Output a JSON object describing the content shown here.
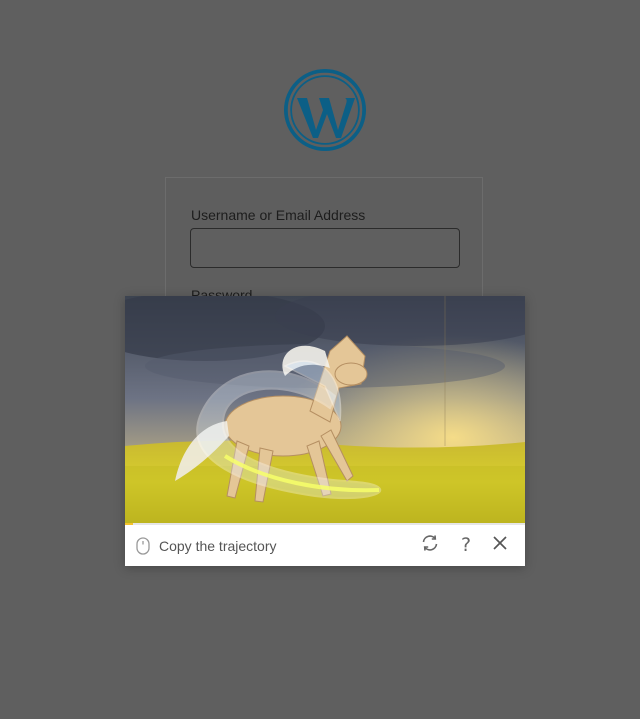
{
  "login": {
    "username_label": "Username or Email Address",
    "username_value": "",
    "password_label": "Password"
  },
  "captcha": {
    "instruction": "Copy the trajectory",
    "icons": {
      "mouse": "mouse-icon",
      "refresh": "refresh-icon",
      "help": "help-icon",
      "close": "close-icon"
    },
    "help_glyph": "?"
  },
  "colors": {
    "overlay": "#5f5f5f",
    "wordpress_blue": "#0c5f86",
    "captcha_accent": "#f4c32b"
  },
  "icons": {
    "logo": "wordpress-logo-icon"
  }
}
